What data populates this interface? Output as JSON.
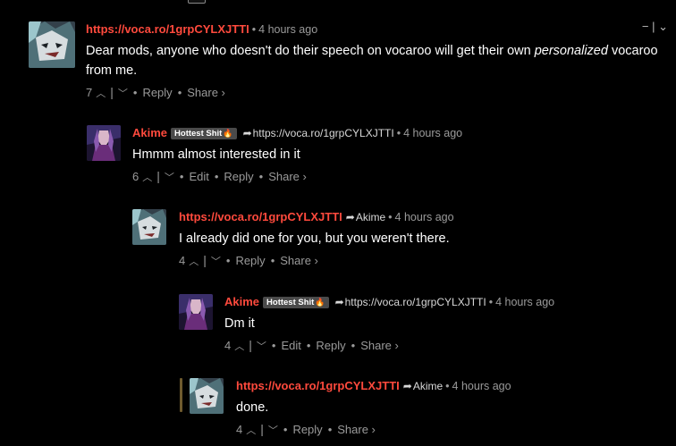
{
  "thread": {
    "collapse_minus": "−",
    "collapse_bar": "|",
    "collapse_chevron": "⌄"
  },
  "comments": [
    {
      "author": "https://voca.ro/1grpCYLXJTTI",
      "time": "4 hours ago",
      "text_before": "Dear mods, anyone who doesn't do their speech on vocaroo will get their own ",
      "text_emphasis": "personalized",
      "text_after": " vocaroo from me.",
      "votes": "7",
      "actions": {
        "reply": "Reply",
        "share": "Share ›"
      }
    },
    {
      "author": "Akime",
      "badge": "Hottest Shit",
      "reply_to": "https://voca.ro/1grpCYLXJTTI",
      "time": "4 hours ago",
      "text": "Hmmm almost interested in it",
      "votes": "6",
      "actions": {
        "edit": "Edit",
        "reply": "Reply",
        "share": "Share ›"
      }
    },
    {
      "author": "https://voca.ro/1grpCYLXJTTI",
      "reply_to": "Akime",
      "time": "4 hours ago",
      "text": "I already did one for you, but you weren't there.",
      "votes": "4",
      "actions": {
        "reply": "Reply",
        "share": "Share ›"
      }
    },
    {
      "author": "Akime",
      "badge": "Hottest Shit",
      "reply_to": "https://voca.ro/1grpCYLXJTTI",
      "time": "4 hours ago",
      "text": "Dm it",
      "votes": "4",
      "actions": {
        "edit": "Edit",
        "reply": "Reply",
        "share": "Share ›"
      }
    },
    {
      "author": "https://voca.ro/1grpCYLXJTTI",
      "reply_to": "Akime",
      "time": "4 hours ago",
      "text": "done.",
      "votes": "4",
      "actions": {
        "reply": "Reply",
        "share": "Share ›"
      }
    }
  ],
  "icons": {
    "upvote": "upvote-chevron-icon",
    "downvote": "downvote-chevron-icon",
    "reply_arrow": "reply-arrow-icon",
    "fire": "fire-icon"
  },
  "colors": {
    "background": "#000000",
    "author": "#ff4a3d",
    "muted": "#9a9a9a",
    "badge_bg": "#4a4a4a",
    "fire": "#ff8a1f",
    "thread_line": "#6f5b2e"
  }
}
